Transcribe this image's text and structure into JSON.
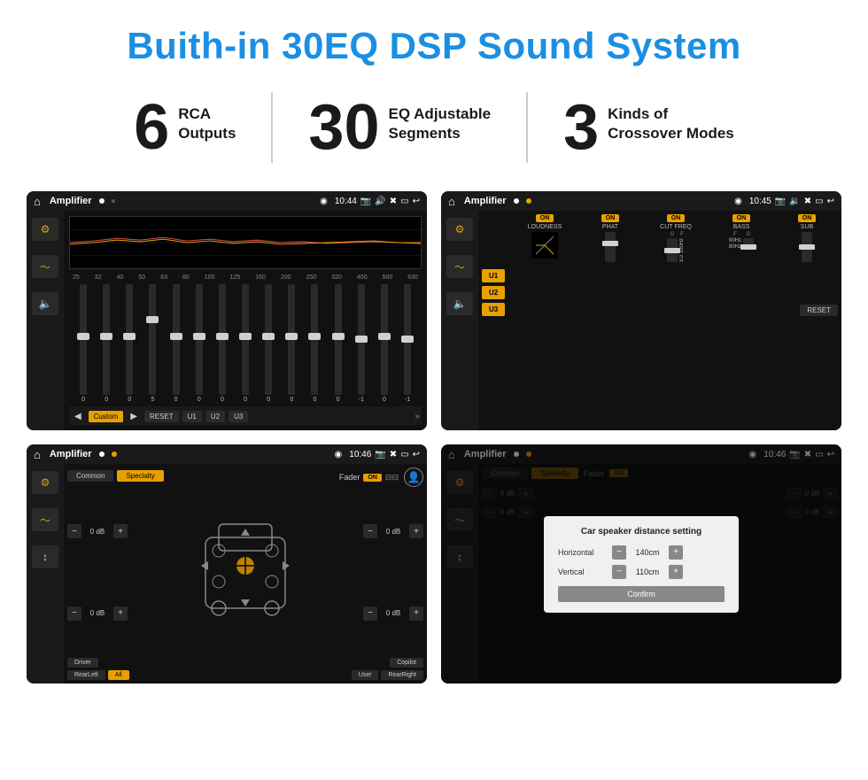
{
  "page": {
    "title": "Buith-in 30EQ DSP Sound System"
  },
  "stats": [
    {
      "number": "6",
      "label1": "RCA",
      "label2": "Outputs"
    },
    {
      "number": "30",
      "label1": "EQ Adjustable",
      "label2": "Segments"
    },
    {
      "number": "3",
      "label1": "Kinds of",
      "label2": "Crossover Modes"
    }
  ],
  "screens": {
    "eq_screen": {
      "title": "Amplifier",
      "time": "10:44",
      "freqs": [
        "25",
        "32",
        "40",
        "50",
        "63",
        "80",
        "100",
        "125",
        "160",
        "200",
        "250",
        "320",
        "400",
        "500",
        "630"
      ],
      "values": [
        "0",
        "0",
        "0",
        "5",
        "0",
        "0",
        "0",
        "0",
        "0",
        "0",
        "0",
        "0",
        "-1",
        "0",
        "-1"
      ],
      "nav_buttons": [
        "Custom",
        "RESET",
        "U1",
        "U2",
        "U3"
      ]
    },
    "crossover_screen": {
      "title": "Amplifier",
      "time": "10:45",
      "presets": [
        "U1",
        "U2",
        "U3"
      ],
      "sections": [
        "LOUDNESS",
        "PHAT",
        "CUT FREQ",
        "BASS",
        "SUB"
      ],
      "reset_label": "RESET"
    },
    "fader_screen": {
      "title": "Amplifier",
      "time": "10:46",
      "tabs": [
        "Common",
        "Specialty"
      ],
      "fader_label": "Fader",
      "on_label": "ON",
      "controls": [
        {
          "label": "Driver",
          "value1": "0 dB",
          "value2": "0 dB"
        },
        {
          "label": "Copilot",
          "value1": "0 dB",
          "value2": "0 dB"
        }
      ],
      "bottom_buttons": [
        "Driver",
        "RearLeft",
        "All",
        "User",
        "RearRight",
        "Copilot"
      ]
    },
    "distance_screen": {
      "title": "Amplifier",
      "time": "10:46",
      "tabs": [
        "Common",
        "Specialty"
      ],
      "dialog": {
        "title": "Car speaker distance setting",
        "horizontal_label": "Horizontal",
        "horizontal_value": "140cm",
        "vertical_label": "Vertical",
        "vertical_value": "110cm",
        "confirm_label": "Confirm"
      }
    }
  },
  "colors": {
    "accent": "#e8a000",
    "blue": "#1a8fe3",
    "dark": "#111111",
    "dark_mid": "#1a1a1a",
    "text_light": "#cccccc",
    "text_dim": "#888888"
  }
}
